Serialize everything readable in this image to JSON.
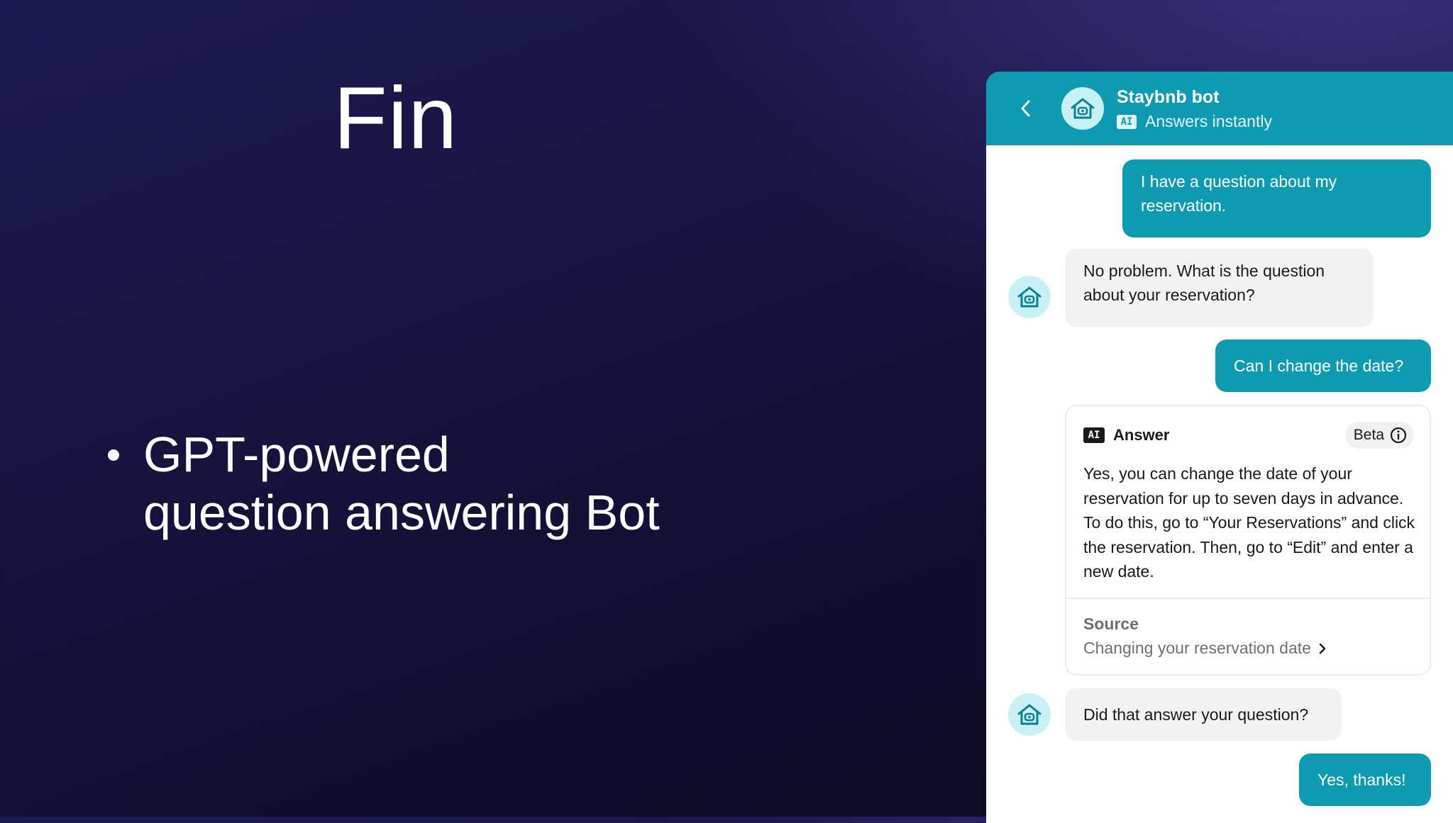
{
  "slide": {
    "title": "Fin",
    "bullet_line1": "GPT-powered",
    "bullet_line2": "question answering Bot"
  },
  "chat": {
    "header": {
      "bot_name": "Staybnb bot",
      "ai_badge": "AI",
      "status": "Answers instantly",
      "back_icon": "chevron-left-icon",
      "avatar_icon": "house-bot-icon"
    },
    "messages": {
      "user1": "I have a question about my reservation.",
      "bot1": "No problem. What is the question about your reservation?",
      "user2": "Can I change the date?",
      "bot2": "Did that answer your question?",
      "user3": "Yes, thanks!"
    },
    "answer_card": {
      "ai_badge": "AI",
      "label": "Answer",
      "beta_label": "Beta",
      "info_icon": "info-icon",
      "body": "Yes, you can change the date of your reservation for up to seven days in advance. To do this, go to “Your Reservations” and click the reservation. Then, go to “Edit” and enter a new date.",
      "source_label": "Source",
      "source_link": "Changing your reservation date"
    }
  },
  "colors": {
    "accent": "#0e9bb2",
    "avatar_bg": "#c8f1f6",
    "bot_bubble": "#f2f2f2"
  }
}
